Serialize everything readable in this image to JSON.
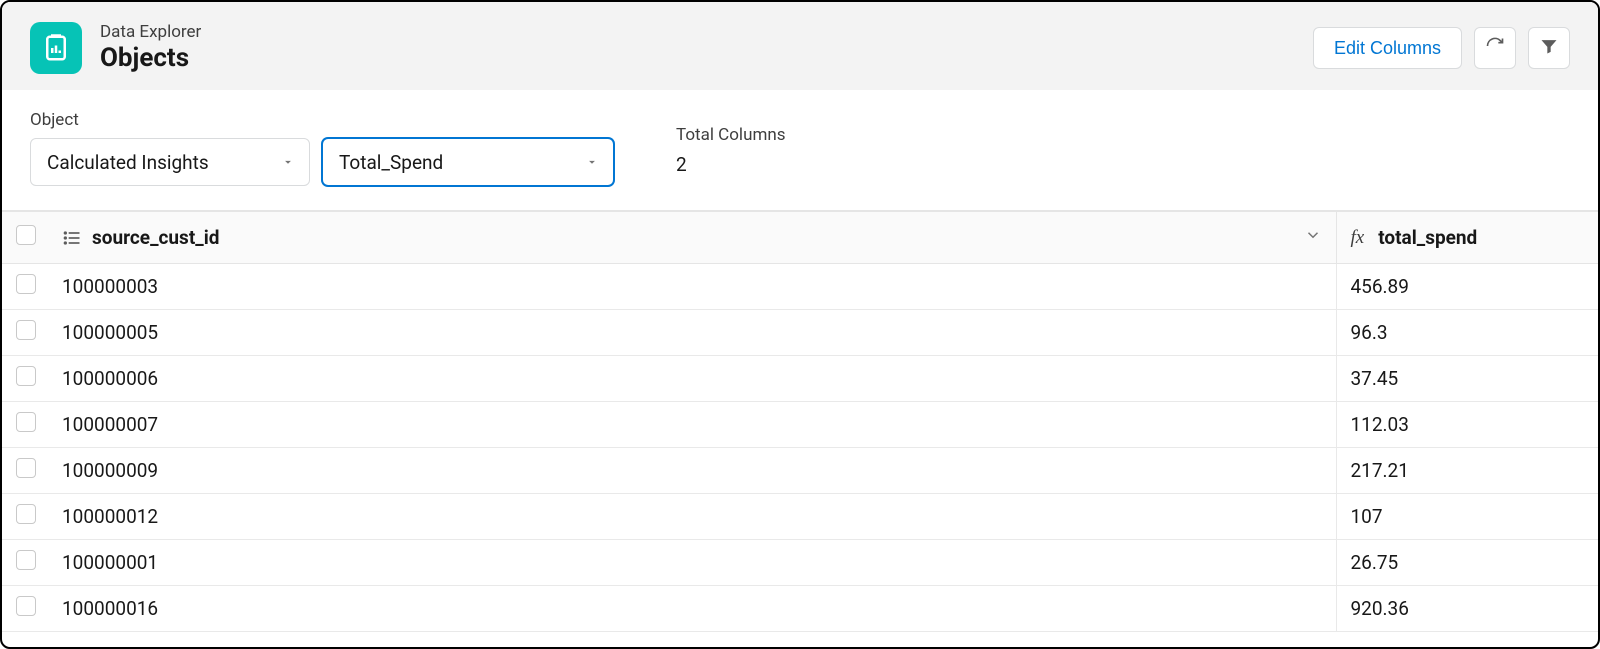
{
  "header": {
    "subtitle": "Data Explorer",
    "title": "Objects",
    "edit_columns_label": "Edit Columns"
  },
  "controls": {
    "object_label": "Object",
    "object_value": "Calculated Insights",
    "secondary_value": "Total_Spend",
    "total_columns_label": "Total Columns",
    "total_columns_value": "2"
  },
  "table": {
    "columns": {
      "id_label": "source_cust_id",
      "spend_label": "total_spend"
    },
    "rows": [
      {
        "id": "100000003",
        "spend": "456.89"
      },
      {
        "id": "100000005",
        "spend": "96.3"
      },
      {
        "id": "100000006",
        "spend": "37.45"
      },
      {
        "id": "100000007",
        "spend": "112.03"
      },
      {
        "id": "100000009",
        "spend": "217.21"
      },
      {
        "id": "100000012",
        "spend": "107"
      },
      {
        "id": "100000001",
        "spend": "26.75"
      },
      {
        "id": "100000016",
        "spend": "920.36"
      }
    ]
  }
}
